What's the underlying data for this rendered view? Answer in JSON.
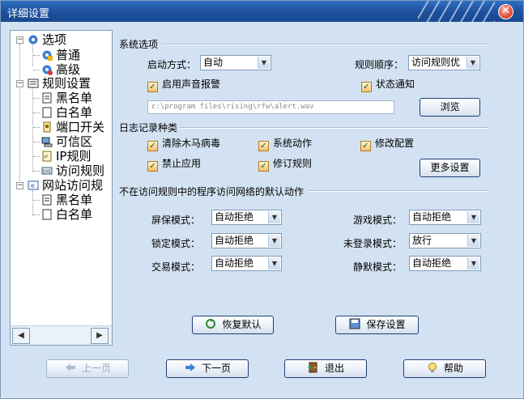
{
  "window": {
    "title": "详细设置",
    "close_glyph": "✕"
  },
  "tree": {
    "items": [
      {
        "label": "选项",
        "icon": "options-gear-icon",
        "expander": "−"
      },
      {
        "label": "普通",
        "icon": "normal-gear-icon"
      },
      {
        "label": "高级",
        "icon": "advanced-gear-icon"
      },
      {
        "label": "规则设置",
        "icon": "rules-settings-icon",
        "expander": "−"
      },
      {
        "label": "黑名单",
        "icon": "blacklist-doc-icon"
      },
      {
        "label": "白名单",
        "icon": "whitelist-doc-icon"
      },
      {
        "label": "端口开关",
        "icon": "port-switch-icon"
      },
      {
        "label": "可信区",
        "icon": "trusted-zone-icon"
      },
      {
        "label": "IP规则",
        "icon": "ip-rules-icon"
      },
      {
        "label": "访问规则",
        "icon": "access-rules-icon"
      },
      {
        "label": "网站访问规",
        "icon": "website-access-icon",
        "expander": "−"
      },
      {
        "label": "黑名单",
        "icon": "blacklist-doc-icon"
      },
      {
        "label": "白名单",
        "icon": "whitelist-doc-icon"
      }
    ],
    "scroll_left": "◀",
    "scroll_right": "▶"
  },
  "system_options": {
    "section_title": "系统选项",
    "startup_label": "启动方式：",
    "startup_value": "自动",
    "rule_order_label": "规则顺序：",
    "rule_order_value": "访问规则优",
    "sound_alarm_label": "启用声音报警",
    "sound_alarm_checked": true,
    "status_notify_label": "状态通知",
    "status_notify_checked": true,
    "sound_path": "c:\\program files\\rising\\rfw\\alert.wav",
    "browse_label": "浏览"
  },
  "log_types": {
    "section_title": "日志记录种类",
    "items": [
      {
        "label": "清除木马病毒",
        "checked": true
      },
      {
        "label": "系统动作",
        "checked": true
      },
      {
        "label": "修改配置",
        "checked": true
      },
      {
        "label": "禁止应用",
        "checked": true
      },
      {
        "label": "修订规则",
        "checked": true
      }
    ],
    "more_settings_label": "更多设置"
  },
  "default_actions": {
    "section_title": "不在访问规则中的程序访问网络的默认动作",
    "rows": [
      {
        "label": "屏保模式：",
        "value": "自动拒绝"
      },
      {
        "label": "游戏模式：",
        "value": "自动拒绝"
      },
      {
        "label": "锁定模式：",
        "value": "自动拒绝"
      },
      {
        "label": "未登录模式：",
        "value": "放行"
      },
      {
        "label": "交易模式：",
        "value": "自动拒绝"
      },
      {
        "label": "静默模式：",
        "value": "自动拒绝"
      }
    ]
  },
  "actions": {
    "restore_default_label": "恢复默认",
    "save_settings_label": "保存设置"
  },
  "nav": {
    "prev_label": "上一页",
    "next_label": "下一页",
    "exit_label": "退出",
    "help_label": "帮助"
  },
  "dropdown_glyph": "▼",
  "check_glyph": "✓"
}
